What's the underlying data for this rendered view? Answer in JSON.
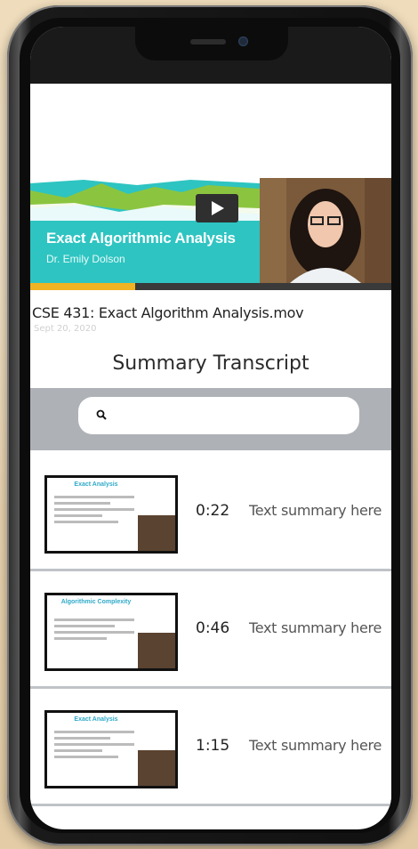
{
  "video": {
    "title": "Exact Algorithmic Analysis",
    "presenter": "Dr. Emily Dolson",
    "progress": 0.29
  },
  "file": {
    "title": "CSE 431: Exact Algorithm Analysis.mov",
    "date": "Sept 20, 2020"
  },
  "summary_title": "Summary Transcript",
  "search": {
    "placeholder": "",
    "value": ""
  },
  "transcript": [
    {
      "thumb_title": "Exact Analysis",
      "time": "0:22",
      "summary": "Text summary here"
    },
    {
      "thumb_title": "Algorithmic Complexity",
      "time": "0:46",
      "summary": "Text summary here"
    },
    {
      "thumb_title": "Exact Analysis",
      "time": "1:15",
      "summary": "Text summary here"
    }
  ],
  "colors": {
    "accent": "#2fc3c2",
    "progress": "#f0b323",
    "searchbar": "#aeb2b6"
  }
}
